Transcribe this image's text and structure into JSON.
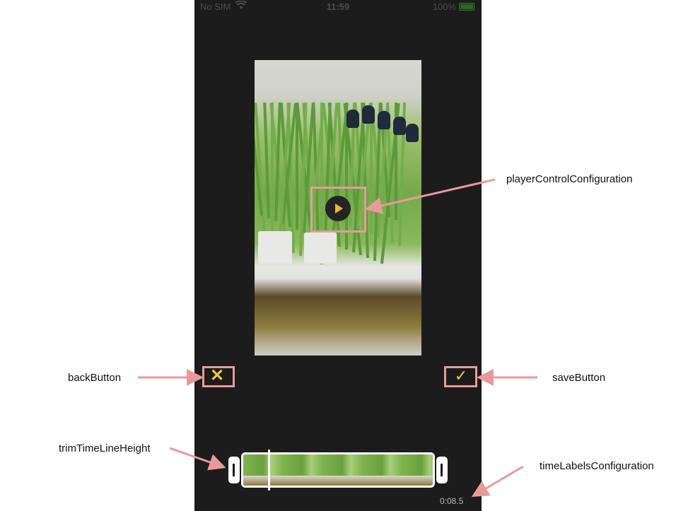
{
  "status_bar": {
    "carrier": "No SIM",
    "time": "11:59",
    "battery": "100%"
  },
  "icons": {
    "wifi": "wifi-icon",
    "battery": "battery-icon",
    "play": "play-icon",
    "back": "close-x-icon",
    "save": "checkmark-icon"
  },
  "controls": {
    "back_glyph": "✕",
    "save_glyph": "✓"
  },
  "timeline": {
    "duration_label": "0:08.5",
    "playhead_fraction": 0.14
  },
  "annotations": {
    "player_control": "playerControlConfiguration",
    "back_button": "backButton",
    "save_button": "saveButton",
    "trim_height": "trimTimeLineHeight",
    "time_labels": "timeLabelsConfiguration"
  },
  "colors": {
    "accent": "#f2c04a",
    "annotation": "#e89a9a",
    "background": "#1c1c1c"
  }
}
